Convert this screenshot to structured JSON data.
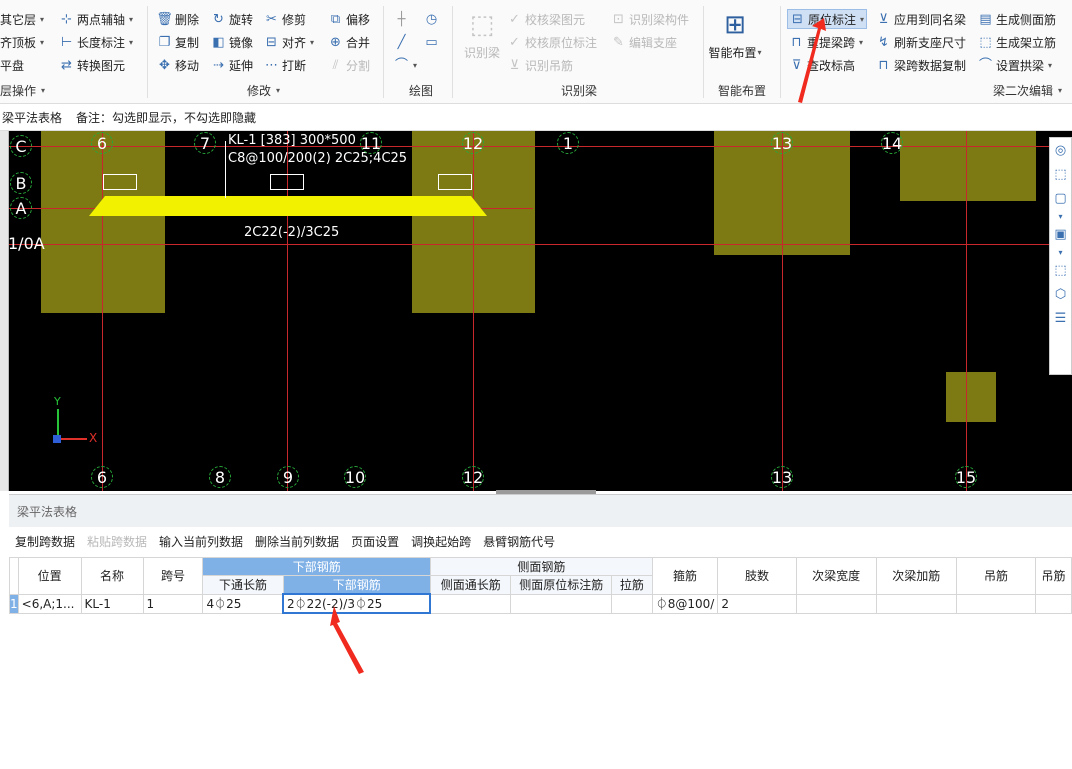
{
  "ribbon": {
    "col1": [
      {
        "label": "其它层",
        "icon": "layers-icon",
        "dd": true
      },
      {
        "label": "齐顶板",
        "icon": "align-icon",
        "dd": true
      },
      {
        "label": "平盘",
        "icon": "panel-icon",
        "dd": false
      }
    ],
    "col1_group": "层操作",
    "col2": [
      {
        "label": "两点辅轴",
        "icon": "axis-icon",
        "dd": true
      },
      {
        "label": "长度标注",
        "icon": "dimension-icon",
        "dd": true
      },
      {
        "label": "转换图元",
        "icon": "convert-icon",
        "dd": false
      }
    ],
    "modify": [
      [
        {
          "label": "删除",
          "icon": "delete-icon"
        },
        {
          "label": "旋转",
          "icon": "rotate-icon"
        },
        {
          "label": "修剪",
          "icon": "trim-icon"
        },
        {
          "label": "偏移",
          "icon": "offset-icon"
        }
      ],
      [
        {
          "label": "复制",
          "icon": "copy-icon"
        },
        {
          "label": "镜像",
          "icon": "mirror-icon"
        },
        {
          "label": "对齐",
          "icon": "align-icon",
          "dd": true
        },
        {
          "label": "合并",
          "icon": "merge-icon"
        }
      ],
      [
        {
          "label": "移动",
          "icon": "move-icon"
        },
        {
          "label": "延伸",
          "icon": "extend-icon"
        },
        {
          "label": "打断",
          "icon": "break-icon"
        },
        {
          "label": "分割",
          "icon": "split-icon",
          "disabled": true
        }
      ]
    ],
    "modify_group": "修改",
    "draw_group": "绘图",
    "identify": {
      "big_label": "识别梁",
      "items": [
        {
          "label": "校核梁图元"
        },
        {
          "label": "识别梁构件"
        },
        {
          "label": "校核原位标注"
        },
        {
          "label": "编辑支座"
        },
        {
          "label": "识别吊筋"
        }
      ],
      "group": "识别梁"
    },
    "smart": {
      "label": "智能布置",
      "group": "智能布置"
    },
    "beam2": [
      [
        {
          "label": "原位标注",
          "icon": "annotate-icon",
          "dd": true,
          "active": true
        },
        {
          "label": "应用到同名梁",
          "icon": "apply-icon"
        },
        {
          "label": "生成侧面筋",
          "icon": "side-rebar-icon"
        }
      ],
      [
        {
          "label": "重提梁跨",
          "icon": "span-icon",
          "dd": true
        },
        {
          "label": "刷新支座尺寸",
          "icon": "refresh-icon"
        },
        {
          "label": "生成架立筋",
          "icon": "frame-rebar-icon"
        }
      ],
      [
        {
          "label": "查改标高",
          "icon": "elevation-icon"
        },
        {
          "label": "梁跨数据复制",
          "icon": "copy-span-icon"
        },
        {
          "label": "设置拱梁",
          "icon": "arch-icon",
          "dd": true
        }
      ]
    ],
    "beam2_group": "梁二次编辑"
  },
  "notebar": {
    "checkbox_label": "梁平法表格",
    "note": "备注：勾选即显示，不勾选即隐藏"
  },
  "canvas": {
    "beam_label_1": "KL-1 [383] 300*500",
    "beam_label_2": "C8@100/200(2) 2C25;4C25",
    "beam_bottom": "2C22(-2)/3C25",
    "top_axes": [
      "6",
      "7",
      "11",
      "12",
      "1",
      "13",
      "14"
    ],
    "bottom_axes": [
      "6",
      "8",
      "9",
      "10",
      "12",
      "13",
      "15"
    ],
    "row_axes": [
      "C",
      "B",
      "A",
      "1/0A"
    ],
    "x_axis": "X",
    "y_axis": "Y",
    "beam_color": "#f2f200",
    "column_color": "#7d7a14"
  },
  "panel": {
    "title": "梁平法表格",
    "toolbar": [
      {
        "label": "复制跨数据",
        "disabled": false
      },
      {
        "label": "粘贴跨数据",
        "disabled": true
      },
      {
        "label": "输入当前列数据",
        "disabled": false
      },
      {
        "label": "删除当前列数据",
        "disabled": false
      },
      {
        "label": "页面设置",
        "disabled": false
      },
      {
        "label": "调换起始跨",
        "disabled": false
      },
      {
        "label": "悬臂钢筋代号",
        "disabled": false
      }
    ],
    "headers": {
      "position": "位置",
      "name": "名称",
      "span": "跨号",
      "bottom_group": "下部钢筋",
      "bottom_through": "下通长筋",
      "bottom_rebar": "下部钢筋",
      "side_group": "侧面钢筋",
      "side_through": "侧面通长筋",
      "side_local": "侧面原位标注筋",
      "tie": "拉筋",
      "stirrup": "箍筋",
      "legs": "肢数",
      "sec_width": "次梁宽度",
      "sec_add": "次梁加筋",
      "hanger": "吊筋",
      "hanger2": "吊筋"
    },
    "row": {
      "no": "1",
      "position": "<6,A;1...",
      "name": "KL-1",
      "span": "1",
      "bottom_through": "4⏀25",
      "bottom_rebar": "2⏀22(-2)/3⏀25",
      "side_through": "",
      "side_local": "",
      "tie": "",
      "stirrup": "⏀8@100/",
      "legs": "2",
      "sec_width": "",
      "sec_add": "",
      "hanger": "",
      "hanger2": ""
    }
  }
}
